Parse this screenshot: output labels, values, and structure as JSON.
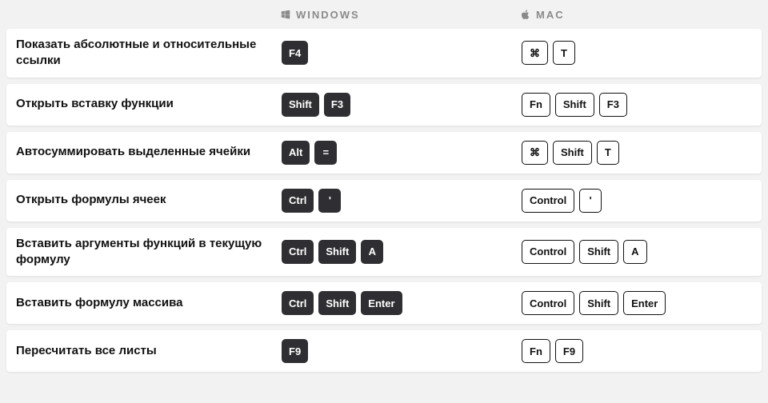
{
  "headers": {
    "windows": "WINDOWS",
    "mac": "MAC"
  },
  "icons": {
    "windows": "windows-icon",
    "mac": "apple-icon",
    "cmd": "⌘"
  },
  "rows": [
    {
      "label": "Показать абсолютные и относительные ссылки",
      "win": [
        "F4"
      ],
      "mac": [
        "⌘",
        "T"
      ]
    },
    {
      "label": "Открыть вставку функции",
      "win": [
        "Shift",
        "F3"
      ],
      "mac": [
        "Fn",
        "Shift",
        "F3"
      ]
    },
    {
      "label": "Автосуммировать выделенные ячейки",
      "win": [
        "Alt",
        "="
      ],
      "mac": [
        "⌘",
        "Shift",
        "T"
      ]
    },
    {
      "label": "Открыть формулы ячеек",
      "win": [
        "Ctrl",
        "'"
      ],
      "mac": [
        "Control",
        "'"
      ]
    },
    {
      "label": "Вставить аргументы функций в текущую формулу",
      "win": [
        "Ctrl",
        "Shift",
        "A"
      ],
      "mac": [
        "Control",
        "Shift",
        "A"
      ]
    },
    {
      "label": "Вставить формулу массива",
      "win": [
        "Ctrl",
        "Shift",
        "Enter"
      ],
      "mac": [
        "Control",
        "Shift",
        "Enter"
      ]
    },
    {
      "label": "Пересчитать все листы",
      "win": [
        "F9"
      ],
      "mac": [
        "Fn",
        "F9"
      ]
    }
  ]
}
